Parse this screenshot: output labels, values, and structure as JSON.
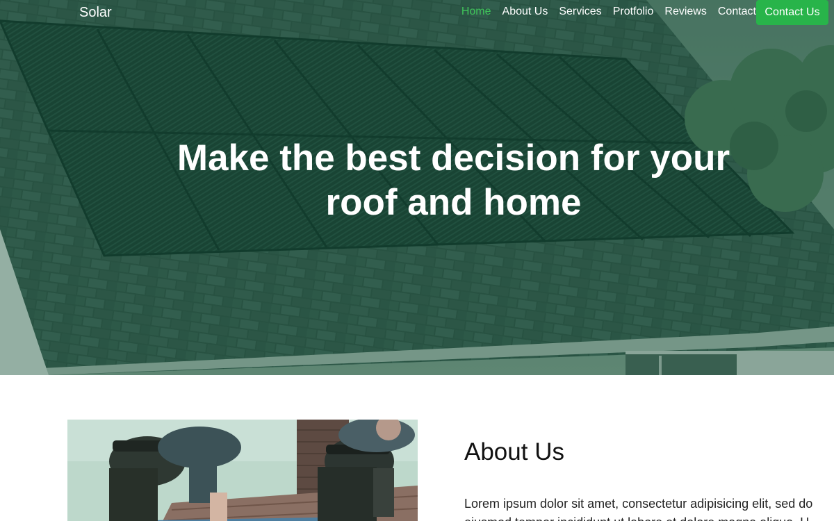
{
  "nav": {
    "logo": "Solar",
    "links": [
      {
        "label": "Home",
        "active": true
      },
      {
        "label": "About Us",
        "active": false
      },
      {
        "label": "Services",
        "active": false
      },
      {
        "label": "Protfolio",
        "active": false
      },
      {
        "label": "Reviews",
        "active": false
      },
      {
        "label": "Contact",
        "active": false
      }
    ],
    "cta_label": "Contact Us"
  },
  "hero": {
    "title_line1": "Make the best decision for your",
    "title_line2": "roof and home",
    "image": "solar-roof-photo"
  },
  "about": {
    "heading": "About Us",
    "text_line1": "Lorem ipsum dolor sit amet, consectetur adipisicing elit, sed do",
    "text_line2": "eiusmod tempor incididunt ut labore et dolore magna aliqua. U",
    "image": "solar-installers-photo"
  },
  "colors": {
    "accent": "#28b44a",
    "active_link": "#3fc45a",
    "hero_overlay": "#0a462d"
  }
}
